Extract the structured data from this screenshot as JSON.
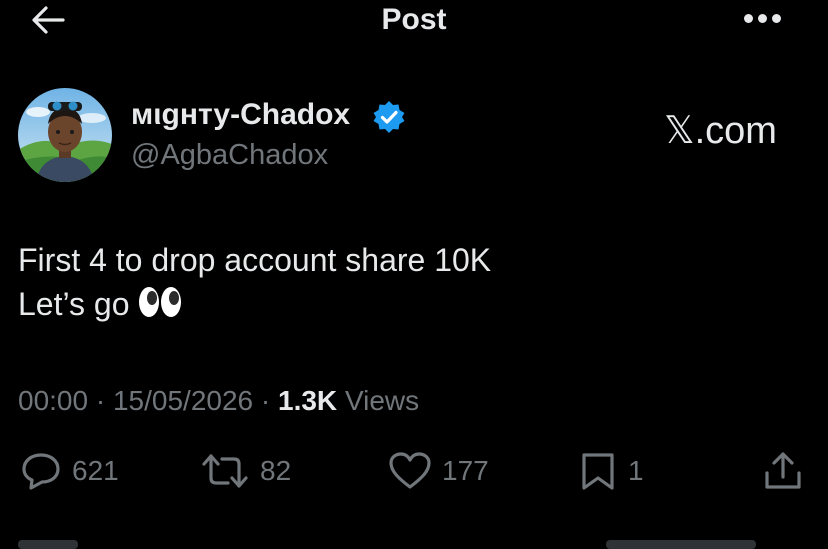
{
  "header": {
    "title": "Post",
    "back_icon": "arrow-left-icon",
    "more_icon": "more-horizontal-icon"
  },
  "author": {
    "display_name": "мιgнту-Chadox",
    "handle": "@AgbaChadox",
    "verified": true,
    "verified_color": "#1d9bf0"
  },
  "watermark": "𝕏.com",
  "tweet": {
    "line1": "First 4 to drop account share 10K",
    "line2": "Let’s go",
    "emoji": "eyes"
  },
  "meta": {
    "time": "00:00",
    "separator": "·",
    "date": "15/05/2026",
    "views_count": "1.3K",
    "views_label": "Views"
  },
  "actions": {
    "replies": "621",
    "reposts": "82",
    "likes": "177",
    "bookmarks": "1"
  },
  "colors": {
    "background": "#000000",
    "primary_text": "#e7e9ea",
    "secondary_text": "#71767b",
    "accent": "#1d9bf0"
  }
}
